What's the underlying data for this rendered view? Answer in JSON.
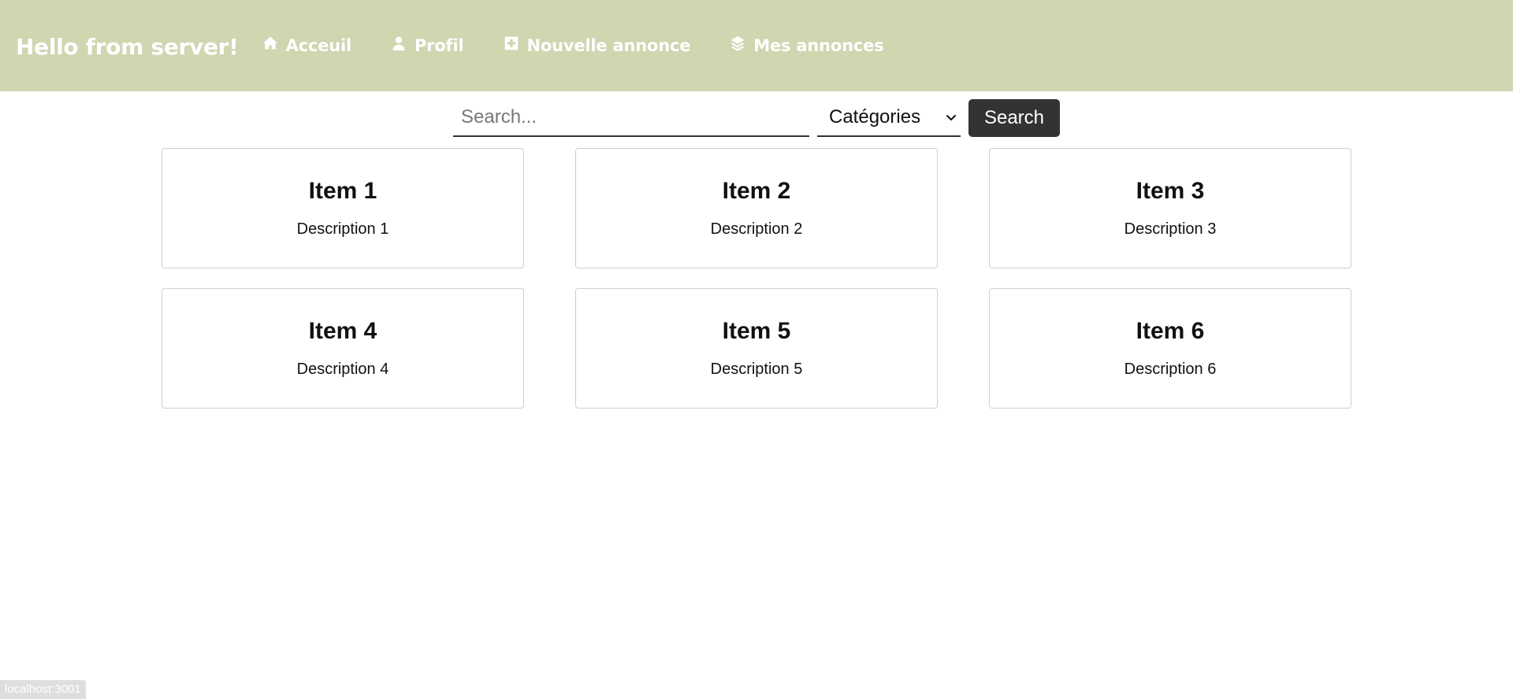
{
  "header": {
    "brand": "Hello from server!",
    "nav": [
      {
        "label": "Acceuil",
        "icon": "home-icon"
      },
      {
        "label": "Profil",
        "icon": "user-icon"
      },
      {
        "label": "Nouvelle annonce",
        "icon": "plus-square-icon"
      },
      {
        "label": "Mes annonces",
        "icon": "layers-icon"
      }
    ],
    "background_color": "#cfd6b0"
  },
  "search": {
    "placeholder": "Search...",
    "value": "",
    "category_selected": "Catégories",
    "button_label": "Search"
  },
  "items": [
    {
      "title": "Item 1",
      "description": "Description 1"
    },
    {
      "title": "Item 2",
      "description": "Description 2"
    },
    {
      "title": "Item 3",
      "description": "Description 3"
    },
    {
      "title": "Item 4",
      "description": "Description 4"
    },
    {
      "title": "Item 5",
      "description": "Description 5"
    },
    {
      "title": "Item 6",
      "description": "Description 6"
    }
  ],
  "status_bar": {
    "url": "localhost:3001"
  }
}
